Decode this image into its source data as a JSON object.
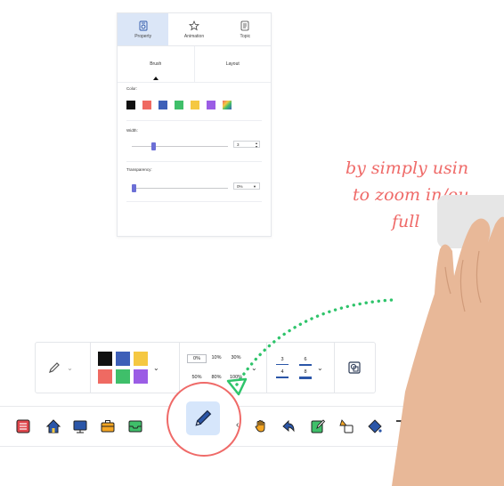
{
  "property_panel": {
    "tabs": [
      {
        "label": "Property",
        "icon": "property-icon"
      },
      {
        "label": "Animation",
        "icon": "animation-star-icon"
      },
      {
        "label": "Topic",
        "icon": "topic-doc-icon"
      }
    ],
    "subtabs": [
      "Brush",
      "Layout"
    ],
    "color_label": "Color:",
    "colors": [
      "#111111",
      "#ef6a62",
      "#3d5fb8",
      "#3fbf6a",
      "#f5c842",
      "#9b5de5",
      "multicolor"
    ],
    "width_label": "Width:",
    "width_value": "3",
    "width_level": 0.2,
    "transparency_label": "Transparency:",
    "transparency_value": "0%",
    "transparency_level": 0.0
  },
  "annotation": {
    "line1": "by simply usin",
    "line2": "to zoom in/ou",
    "line3": "full"
  },
  "style_toolbar": {
    "pen_icon": "pen-icon",
    "colors": [
      "#111111",
      "#3d5fb8",
      "#f5c842",
      "#ef6a62",
      "#3fbf6a",
      "#9b5de5"
    ],
    "percent_options": [
      "0%",
      "10%",
      "30%",
      "50%",
      "80%",
      "100%"
    ],
    "selected_percent": "0%",
    "width_options": [
      "3",
      "6",
      "4",
      "8"
    ],
    "shape_icon": "shape-overlay-icon"
  },
  "main_toolbar": {
    "tools": [
      {
        "name": "list-icon",
        "color": "#e0464c"
      },
      {
        "name": "home-icon",
        "color": "#2b56a8"
      },
      {
        "name": "screen-icon",
        "color": "#2b56a8"
      },
      {
        "name": "briefcase-icon",
        "color": "#f5a623"
      },
      {
        "name": "tray-icon",
        "color": "#3fbf6a"
      },
      {
        "name": "pen-icon",
        "color": "#2b56a8"
      },
      {
        "name": "hand-icon",
        "color": "#f5a623"
      },
      {
        "name": "undo-arrow-icon",
        "color": "#2b56a8"
      },
      {
        "name": "edit-note-icon",
        "color": "#3fbf6a"
      },
      {
        "name": "shapes-icon",
        "color": "#f5a623"
      },
      {
        "name": "fill-icon",
        "color": "#2b56a8"
      },
      {
        "name": "text-icon",
        "color": "#444444"
      }
    ],
    "more_label": "···"
  }
}
